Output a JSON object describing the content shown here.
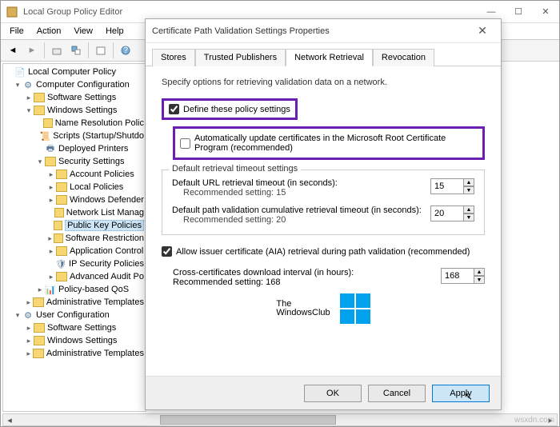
{
  "main": {
    "title": "Local Group Policy Editor",
    "menus": [
      "File",
      "Action",
      "View",
      "Help"
    ]
  },
  "tree": {
    "root": "Local Computer Policy",
    "cc": "Computer Configuration",
    "ss": "Software Settings",
    "ws": "Windows Settings",
    "nrp": "Name Resolution Polic",
    "scr": "Scripts (Startup/Shutdo",
    "dp": "Deployed Printers",
    "sec": "Security Settings",
    "ap": "Account Policies",
    "lp": "Local Policies",
    "wd": "Windows Defender",
    "nlm": "Network List Manag",
    "pkp": "Public Key Policies",
    "sr": "Software Restriction",
    "ac": "Application Control",
    "ipsec": "IP Security Policies",
    "aap": "Advanced Audit Po",
    "qos": "Policy-based QoS",
    "at": "Administrative Templates",
    "uc": "User Configuration",
    "ss2": "Software Settings",
    "ws2": "Windows Settings",
    "at2": "Administrative Templates"
  },
  "dialog": {
    "title": "Certificate Path Validation Settings Properties",
    "tabs": [
      "Stores",
      "Trusted Publishers",
      "Network Retrieval",
      "Revocation"
    ],
    "active_tab": 2,
    "desc": "Specify options for retrieving validation data on a network.",
    "define": "Define these policy settings",
    "auto": "Automatically update certificates in the Microsoft Root Certificate Program (recommended)",
    "grp_legend": "Default retrieval timeout settings",
    "url_l1": "Default URL retrieval timeout (in seconds):",
    "url_l2": "Recommended setting: 15",
    "url_val": "15",
    "path_l1": "Default path validation cumulative retrieval timeout (in seconds):",
    "path_l2": "Recommended setting: 20",
    "path_val": "20",
    "aia": "Allow issuer certificate (AIA) retrieval during path validation (recommended)",
    "cross_l1": "Cross-certificates download interval (in hours):",
    "cross_l2": "Recommended setting: 168",
    "cross_val": "168",
    "logo1": "The",
    "logo2": "WindowsClub",
    "ok": "OK",
    "cancel": "Cancel",
    "apply": "Apply"
  },
  "watermark": "wsxdn.com"
}
